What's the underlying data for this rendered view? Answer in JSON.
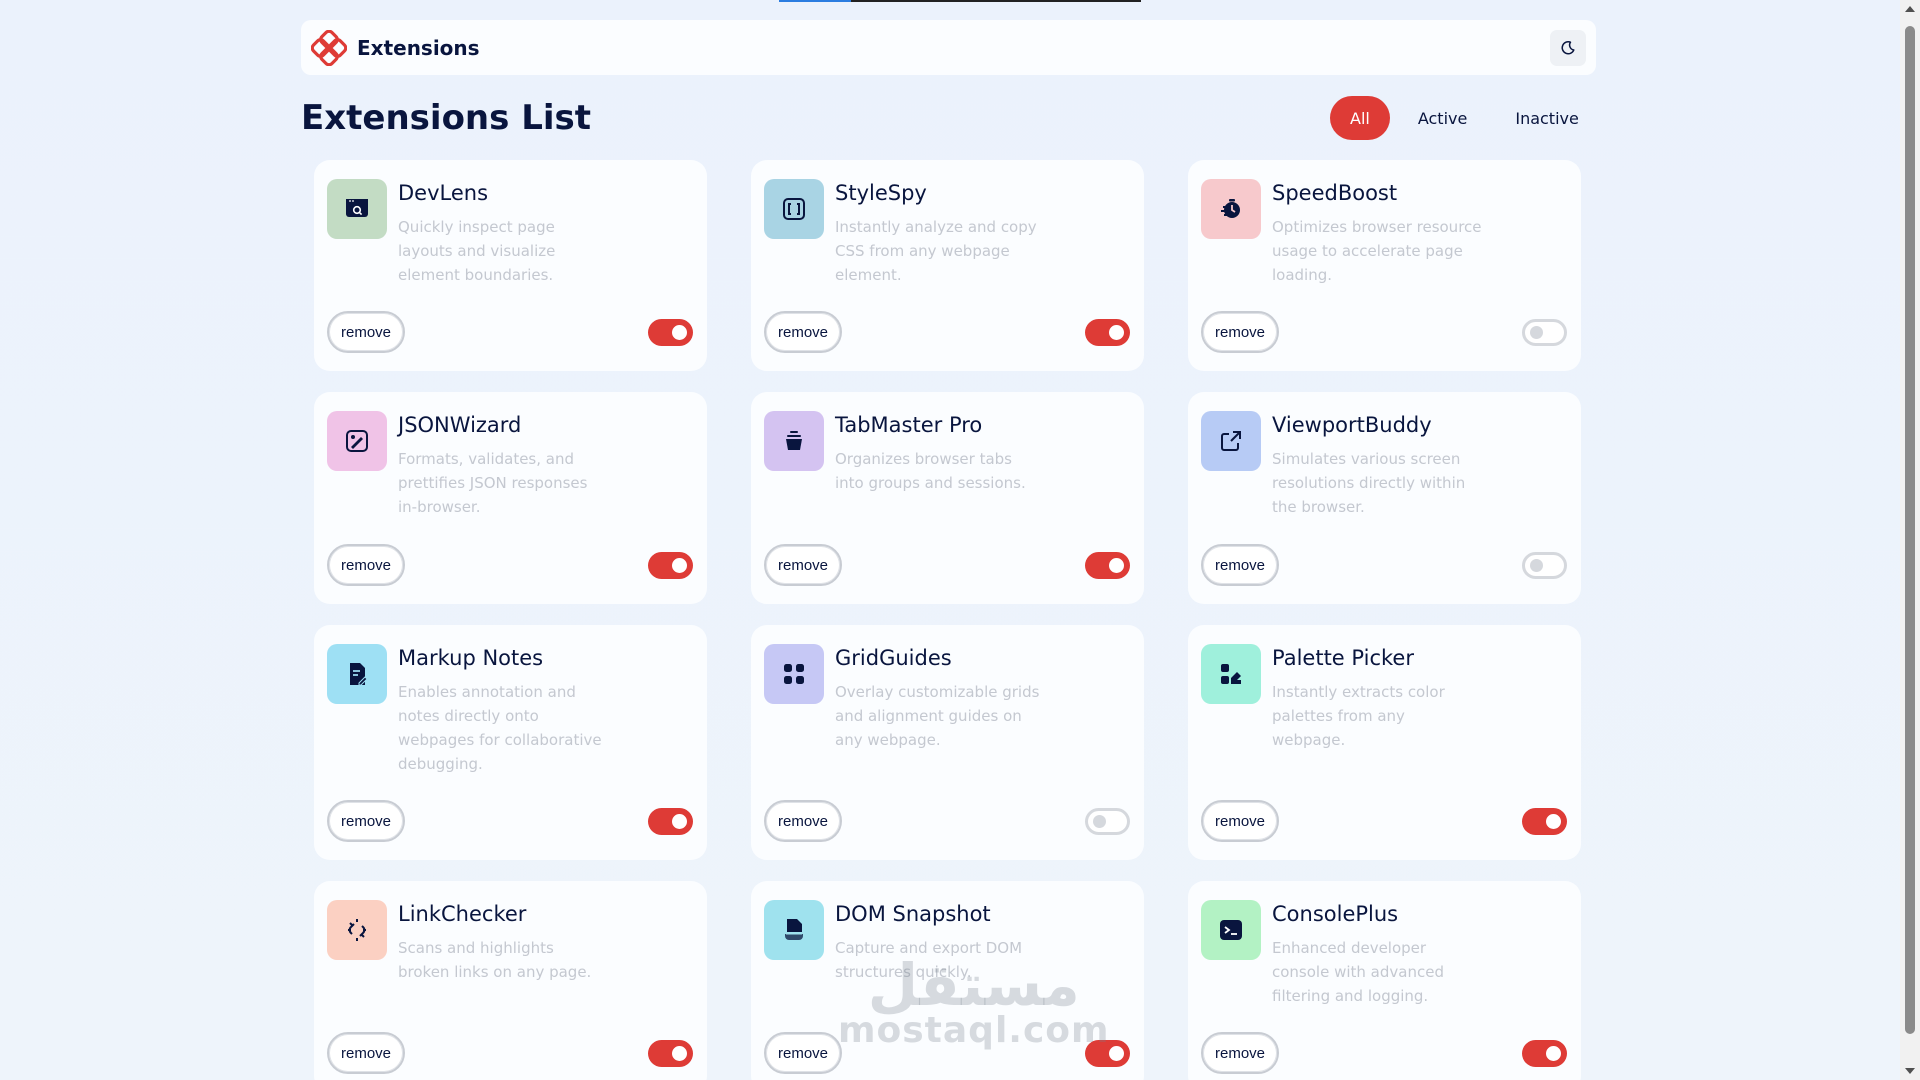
{
  "header": {
    "brand": "Extensions"
  },
  "main": {
    "title": "Extensions List"
  },
  "filters": [
    {
      "label": "All",
      "active": true
    },
    {
      "label": "Active",
      "active": false
    },
    {
      "label": "Inactive",
      "active": false
    }
  ],
  "remove_label": "remove",
  "extensions": [
    {
      "name": "DevLens",
      "description": "Quickly inspect page layouts and visualize element boundaries.",
      "enabled": true,
      "icon": "devlens-icon",
      "icon_bg": "#c3dcc4"
    },
    {
      "name": "StyleSpy",
      "description": "Instantly analyze and copy CSS from any webpage element.",
      "enabled": true,
      "icon": "stylespy-icon",
      "icon_bg": "#a9d4e4"
    },
    {
      "name": "SpeedBoost",
      "description": "Optimizes browser resource usage to accelerate page loading.",
      "enabled": false,
      "icon": "speedboost-icon",
      "icon_bg": "#f7c9cc"
    },
    {
      "name": "JSONWizard",
      "description": "Formats, validates, and prettifies JSON responses in-browser.",
      "enabled": true,
      "icon": "jsonwizard-icon",
      "icon_bg": "#f0c3e7"
    },
    {
      "name": "TabMaster Pro",
      "description": "Organizes browser tabs into groups and sessions.",
      "enabled": true,
      "icon": "tabmaster-icon",
      "icon_bg": "#d4c3f1"
    },
    {
      "name": "ViewportBuddy",
      "description": "Simulates various screen resolutions directly within the browser.",
      "enabled": false,
      "icon": "viewportbuddy-icon",
      "icon_bg": "#b7cbf5"
    },
    {
      "name": "Markup Notes",
      "description": "Enables annotation and notes directly onto webpages for collaborative debugging.",
      "enabled": true,
      "icon": "markupnotes-icon",
      "icon_bg": "#9ee0f4"
    },
    {
      "name": "GridGuides",
      "description": "Overlay customizable grids and alignment guides on any webpage.",
      "enabled": false,
      "icon": "gridguides-icon",
      "icon_bg": "#c6c8f5"
    },
    {
      "name": "Palette Picker",
      "description": "Instantly extracts color palettes from any webpage.",
      "enabled": true,
      "icon": "palettepicker-icon",
      "icon_bg": "#9ff0dc"
    },
    {
      "name": "LinkChecker",
      "description": "Scans and highlights broken links on any page.",
      "enabled": true,
      "icon": "linkchecker-icon",
      "icon_bg": "#fbd0c2"
    },
    {
      "name": "DOM Snapshot",
      "description": "Capture and export DOM structures quickly.",
      "enabled": true,
      "icon": "domsnapshot-icon",
      "icon_bg": "#9fe2ee"
    },
    {
      "name": "ConsolePlus",
      "description": "Enhanced developer console with advanced filtering and logging.",
      "enabled": true,
      "icon": "consoleplus-icon",
      "icon_bg": "#b3f2c4"
    }
  ],
  "watermark": {
    "arabic": "مستقل",
    "latin": "mostaql.com"
  },
  "colors": {
    "accent": "#de3b36",
    "text": "#09153e",
    "muted": "#c4c8d0"
  }
}
